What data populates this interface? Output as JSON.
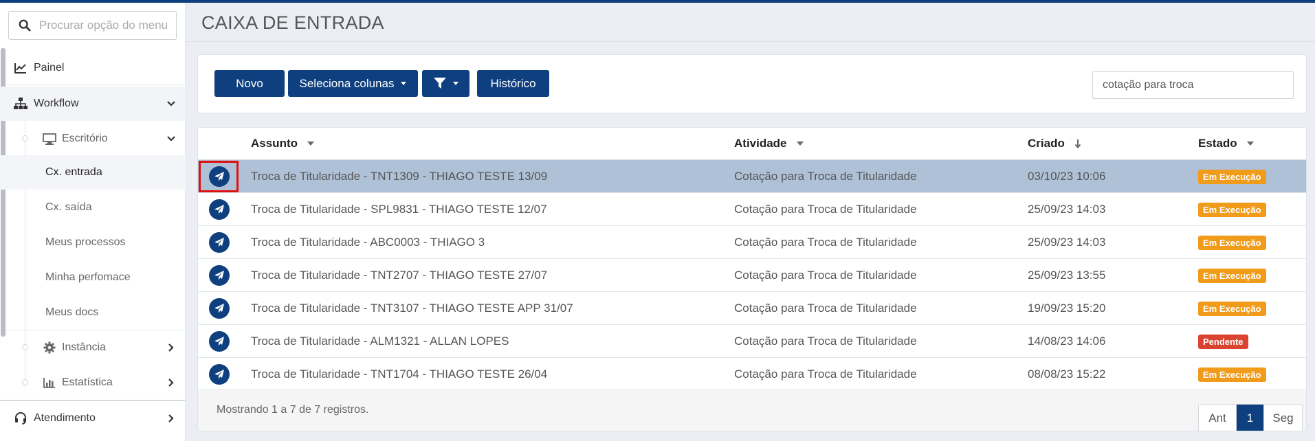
{
  "sidebar": {
    "search_placeholder": "Procurar opção do menu",
    "items": {
      "painel": "Painel",
      "workflow": "Workflow",
      "escritorio": "Escritório",
      "cx_entrada": "Cx. entrada",
      "cx_saida": "Cx. saída",
      "meus_processos": "Meus processos",
      "minha_perfomace": "Minha perfomace",
      "meus_docs": "Meus docs",
      "instancia": "Instância",
      "estatistica": "Estatística",
      "atendimento": "Atendimento"
    }
  },
  "page": {
    "title": "CAIXA DE ENTRADA"
  },
  "toolbar": {
    "novo": "Novo",
    "seleciona_colunas": "Seleciona colunas",
    "historico": "Histórico",
    "filter_value": "cotação para troca"
  },
  "table": {
    "headers": {
      "assunto": "Assunto",
      "atividade": "Atividade",
      "criado": "Criado",
      "estado": "Estado"
    },
    "rows": [
      {
        "assunto": "Troca de Titularidade - TNT1309 - THIAGO TESTE 13/09",
        "atividade": "Cotação para Troca de Titularidade",
        "criado": "03/10/23 10:06",
        "estado": "Em Execução",
        "status": "exec"
      },
      {
        "assunto": "Troca de Titularidade - SPL9831 - THIAGO TESTE 12/07",
        "atividade": "Cotação para Troca de Titularidade",
        "criado": "25/09/23 14:03",
        "estado": "Em Execução",
        "status": "exec"
      },
      {
        "assunto": "Troca de Titularidade - ABC0003 - THIAGO 3",
        "atividade": "Cotação para Troca de Titularidade",
        "criado": "25/09/23 14:03",
        "estado": "Em Execução",
        "status": "exec"
      },
      {
        "assunto": "Troca de Titularidade - TNT2707 - THIAGO TESTE 27/07",
        "atividade": "Cotação para Troca de Titularidade",
        "criado": "25/09/23 13:55",
        "estado": "Em Execução",
        "status": "exec"
      },
      {
        "assunto": "Troca de Titularidade - TNT3107 - THIAGO TESTE APP 31/07",
        "atividade": "Cotação para Troca de Titularidade",
        "criado": "19/09/23 15:20",
        "estado": "Em Execução",
        "status": "exec"
      },
      {
        "assunto": "Troca de Titularidade - ALM1321 - ALLAN LOPES",
        "atividade": "Cotação para Troca de Titularidade",
        "criado": "14/08/23 14:06",
        "estado": "Pendente",
        "status": "pend"
      },
      {
        "assunto": "Troca de Titularidade - TNT1704 - THIAGO TESTE 26/04",
        "atividade": "Cotação para Troca de Titularidade",
        "criado": "08/08/23 15:22",
        "estado": "Em Execução",
        "status": "exec"
      }
    ],
    "footer_info": "Mostrando 1 a 7 de 7 registros.",
    "pager": {
      "prev": "Ant",
      "current": "1",
      "next": "Seg"
    }
  },
  "colors": {
    "brand": "#0e3f7e",
    "exec": "#f19b1b",
    "pend": "#d9432f",
    "selected_row": "#afc1d6",
    "highlight": "#e01010"
  }
}
